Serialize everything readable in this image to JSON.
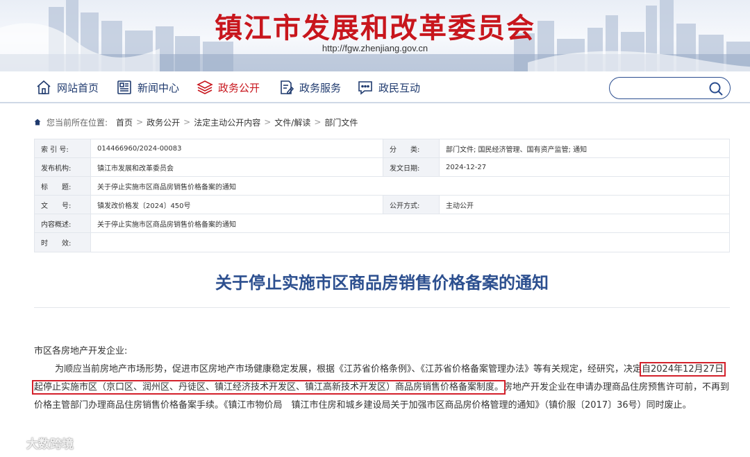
{
  "header": {
    "title": "镇江市发展和改革委员会",
    "url": "http://fgw.zhenjiang.gov.cn"
  },
  "nav": {
    "items": [
      {
        "label": "网站首页",
        "icon": "home-icon"
      },
      {
        "label": "新闻中心",
        "icon": "news-icon"
      },
      {
        "label": "政务公开",
        "icon": "layers-icon",
        "active": true
      },
      {
        "label": "政务服务",
        "icon": "document-edit-icon"
      },
      {
        "label": "政民互动",
        "icon": "chat-icon"
      }
    ],
    "search_placeholder": "",
    "active_color": "#c8161d",
    "nav_color": "#1f3a6e"
  },
  "breadcrumb": {
    "label": "您当前所在位置:",
    "items": [
      "首页",
      "政务公开",
      "法定主动公开内容",
      "文件/解读",
      "部门文件"
    ],
    "separator": ">"
  },
  "meta": {
    "index_label": "索 引 号:",
    "index_value": "014466960/2024-00083",
    "category_label": "分　　类:",
    "category_value": "部门文件;  国民经济管理、国有资产监管;  通知",
    "issuer_label": "发布机构:",
    "issuer_value": "镇江市发展和改革委员会",
    "date_label": "发文日期:",
    "date_value": "2024-12-27",
    "title_label": "标　　题:",
    "title_value": "关于停止实施市区商品房销售价格备案的通知",
    "docno_label": "文　　号:",
    "docno_value": "镇发改价格发〔2024〕450号",
    "public_label": "公开方式:",
    "public_value": "主动公开",
    "summary_label": "内容概述:",
    "summary_value": "关于停止实施市区商品房销售价格备案的通知",
    "validity_label": "时　　效:",
    "validity_value": ""
  },
  "article": {
    "title": "关于停止实施市区商品房销售价格备案的通知",
    "salutation": "市区各房地产开发企业:",
    "p1_a": "为顺应当前房地产市场形势，促进市区房地产市场健康稳定发展，根据《江苏省价格条例》、《江苏省价格备案管理办法》等有关规定，经研究，决定",
    "p1_highlight": "自2024年12月27日起停止实施市区（京口区、润州区、丹徒区、镇江经济技术开发区、镇江高新技术开发区）商品房销售价格备案制度。",
    "p1_b": "房地产开发企业在申请办理商品住房预售许可前，不再到价格主管部门办理商品住房销售价格备案手续。《镇江市物价局　镇江市住房和城乡建设局关于加强市区商品房价格管理的通知》（镇价服〔2017〕36号）同时废止。",
    "highlight_color": "#d3202a",
    "title_color": "#2c4f8f"
  },
  "watermark": {
    "text": "大数跨境",
    "icon": "brand-logo-icon"
  }
}
